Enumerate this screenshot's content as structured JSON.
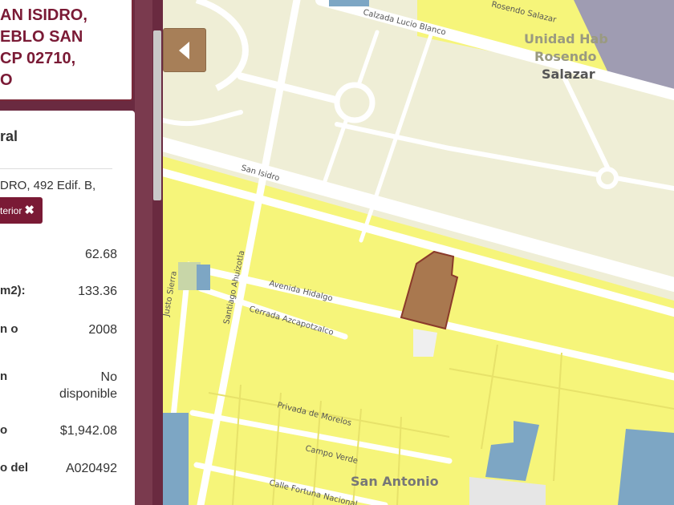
{
  "address": {
    "lines": [
      "AN ISIDRO,",
      "EBLO SAN",
      "CP 02710,",
      "O"
    ]
  },
  "info": {
    "title": "ral",
    "address": "DRO, 492 Edif. B,",
    "prev_button_label": "terior",
    "close_icon": "✖",
    "rows": [
      {
        "label": "",
        "value": "62.68"
      },
      {
        "label": "m2):",
        "value": "133.36"
      },
      {
        "label": "n o",
        "value": "2008"
      },
      {
        "label": "n",
        "value": "No\ndisponible"
      },
      {
        "label": "o",
        "value": "$1,942.08"
      },
      {
        "label": "o del",
        "value": "A020492"
      }
    ]
  },
  "map": {
    "labels": {
      "calzada": "Calzada Lucio Blanco",
      "rosendo_st": "Rosendo Salazar",
      "unidad_1": "Unidad Hab",
      "unidad_2": "Rosendo",
      "salazar": "Salazar",
      "san_isidro": "San Isidro",
      "avenida_hidalgo": "Avenida Hidalgo",
      "cerrada_azcapotzalco": "Cerrada Azcapotzalco",
      "santiago_ahuizotla": "Santiago Ahuizotla",
      "justo_sierra": "Justo Sierra",
      "privada_morelos": "Privada de Morelos",
      "campo_verde": "Campo Verde",
      "san_antonio": "San Antonio",
      "calle_fortuna": "Calle Fortuna Nacional"
    },
    "colors": {
      "residential": "#f6f57a",
      "park": "#efeed6",
      "selected_parcel": "#a9784f",
      "institutional": "#9fa0b4",
      "water_blue": "#7da6c4",
      "panel": "#7a1a35"
    }
  },
  "toggle": {
    "icon": "chevron-left-icon"
  }
}
